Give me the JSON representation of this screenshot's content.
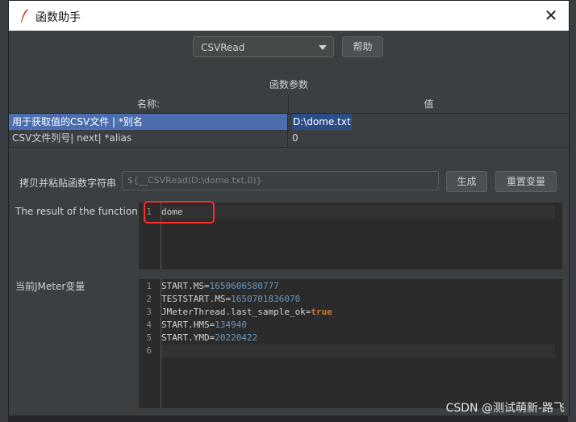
{
  "window": {
    "title": "函数助手"
  },
  "toolbar": {
    "function_selected": "CSVRead",
    "help_label": "帮助"
  },
  "params": {
    "section_title": "函数参数",
    "columns": [
      "名称:",
      "值"
    ],
    "rows": [
      {
        "name": "用于获取值的CSV文件 | *别名",
        "value": "D:\\dome.txt"
      },
      {
        "name": "CSV文件列号| next| *alias",
        "value": "0"
      }
    ]
  },
  "copy": {
    "label": "拷贝并粘贴函数字符串",
    "value": "${__CSVRead(D:\\dome.txt,0)}",
    "generate_label": "生成",
    "reset_label": "重置变量"
  },
  "result": {
    "label": "The result of the function is",
    "lines": [
      {
        "num": "1",
        "text": "dome"
      }
    ]
  },
  "vars": {
    "label": "当前JMeter变量",
    "lines": [
      {
        "num": "1",
        "key": "START.MS=",
        "value": "1650606580777"
      },
      {
        "num": "2",
        "key": "TESTSTART.MS=",
        "value": "1650701836070"
      },
      {
        "num": "3",
        "key": "JMeterThread.last_sample_ok=",
        "value": "true"
      },
      {
        "num": "4",
        "key": "START.HMS=",
        "value": "134940"
      },
      {
        "num": "5",
        "key": "START.YMD=",
        "value": "20220422"
      },
      {
        "num": "6",
        "key": "",
        "value": ""
      }
    ]
  },
  "watermark": "CSDN @测试萌新-路飞",
  "colors": {
    "selection": "#4b6eaf",
    "number": "#6897bb",
    "keyword": "#cc7832",
    "highlight_box": "#ff2a2a"
  }
}
